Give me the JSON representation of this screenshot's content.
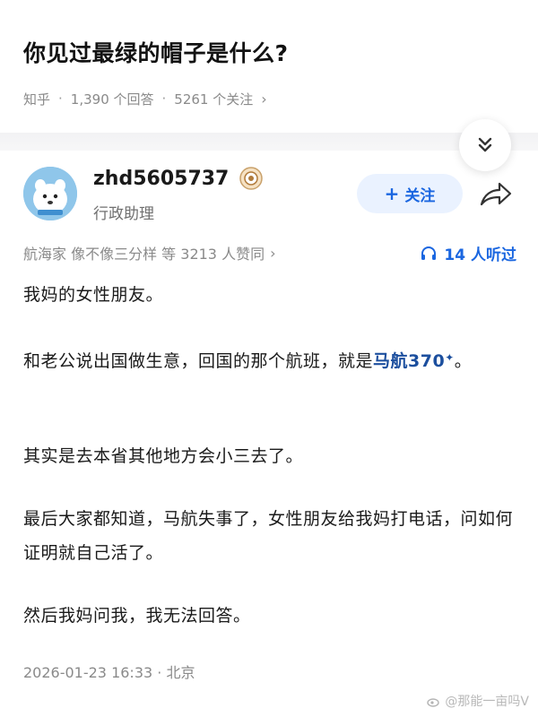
{
  "question": {
    "title": "你见过最绿的帽子是什么?",
    "source": "知乎",
    "answers": "1,390 个回答",
    "followers": "5261 个关注",
    "sep": "·",
    "chevron": "›"
  },
  "author": {
    "name": "zhd5605737",
    "title": "行政助理",
    "follow_label": "关注",
    "follow_plus": "+"
  },
  "stats": {
    "voters": "航海家 像不像三分样 等 3213 人赞同",
    "chevron": "›",
    "listeners": "14 人听过"
  },
  "content": {
    "p1": "我妈的女性朋友。",
    "p2_prefix": "和老公说出国做生意，回国的那个航班，就是",
    "p2_link": "马航370",
    "p2_suffix": "。",
    "p3": "其实是去本省其他地方会小三去了。",
    "p4": "最后大家都知道，马航失事了，女性朋友给我妈打电话，问如何证明就自己活了。",
    "p5": "然后我妈问我，我无法回答。"
  },
  "footer": {
    "timestamp": "2026-01-23 16:33 · 北京"
  },
  "watermark": {
    "text": "@那能一亩吗V"
  },
  "icons": {
    "collapse": "double-chevron-down-icon",
    "share": "share-arrow-icon",
    "headphones": "headphones-icon",
    "badge": "creator-badge-icon"
  },
  "colors": {
    "accent": "#1a66e0",
    "link": "#1c4f9e",
    "follow_bg": "#eaf2ff",
    "avatar_bg": "#8fc6ea"
  }
}
